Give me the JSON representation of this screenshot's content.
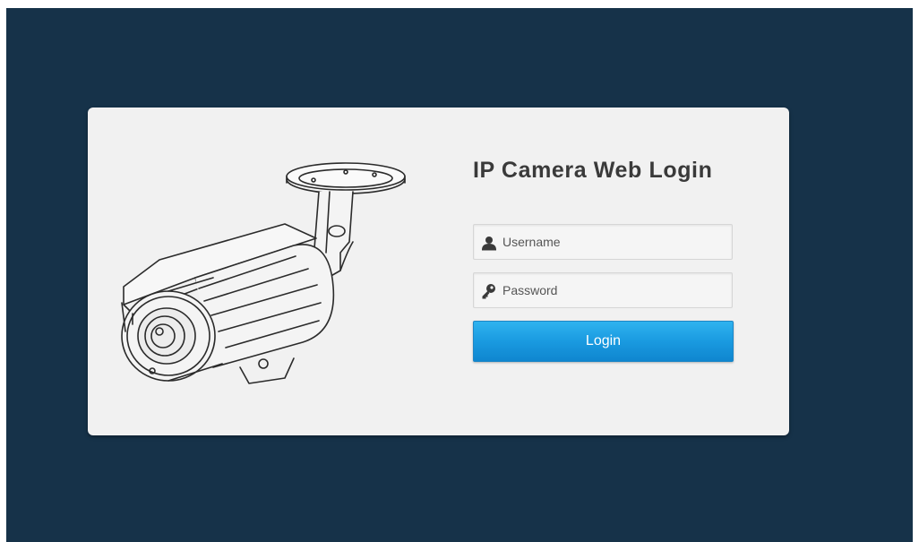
{
  "login": {
    "title": "IP Camera Web Login",
    "username_placeholder": "Username",
    "username_value": "",
    "password_placeholder": "Password",
    "password_value": "",
    "login_button": "Login"
  },
  "icons": {
    "username": "user-icon",
    "password": "key-icon",
    "illustration": "bullet-camera-illustration"
  },
  "colors": {
    "background": "#163249",
    "card": "#f1f1f1",
    "title": "#3a3a3a",
    "button": "#1a9ae0",
    "button_text": "#ffffff"
  }
}
